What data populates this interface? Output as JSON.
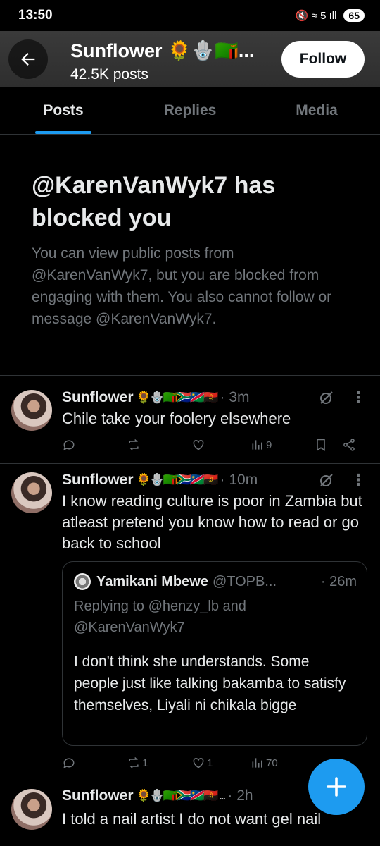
{
  "status_bar": {
    "time": "13:50",
    "icons": "🔇 ≈ 5 ıll",
    "battery": "65"
  },
  "header": {
    "name": "Sunflower 🌻🪬🇿🇲...",
    "posts_count": "42.5K posts",
    "follow_label": "Follow"
  },
  "tabs": [
    {
      "label": "Posts"
    },
    {
      "label": "Replies"
    },
    {
      "label": "Media"
    }
  ],
  "blocked": {
    "title": "@KarenVanWyk7 has blocked you",
    "description": "You can view public posts from @KarenVanWyk7, but you are blocked from engaging with them. You also cannot follow or message @KarenVanWyk7."
  },
  "posts": [
    {
      "name": "Sunflower",
      "emoji": "🌻🪬🇿🇲🇿🇦🇳🇦🇦🇴",
      "time": "· 3m",
      "text": "Chile take your foolery elsewhere",
      "replies": "",
      "reposts": "",
      "likes": "",
      "views": "9"
    },
    {
      "name": "Sunflower",
      "emoji": "🌻🪬🇿🇲🇿🇦🇳🇦🇦🇴",
      "time": "· 10m",
      "text": "I know reading culture is poor in Zambia but atleast pretend you know how to read or go back to school",
      "quote": {
        "name": "Yamikani Mbewe",
        "handle": "@TOPB...",
        "time": "· 26m",
        "replying_to": "Replying to @henzy_lb and @KarenVanWyk7",
        "text": "I don't think she understands. Some people just like talking bakamba to satisfy themselves, Liyali ni chikala bigge"
      },
      "replies": "",
      "reposts": "1",
      "likes": "1",
      "views": "70"
    },
    {
      "name": "Sunflower",
      "emoji": "🌻🪬🇿🇲🇿🇦🇳🇦🇦🇴 ...",
      "time": "· 2h",
      "text": "I told a nail artist I do not want gel nail"
    }
  ]
}
